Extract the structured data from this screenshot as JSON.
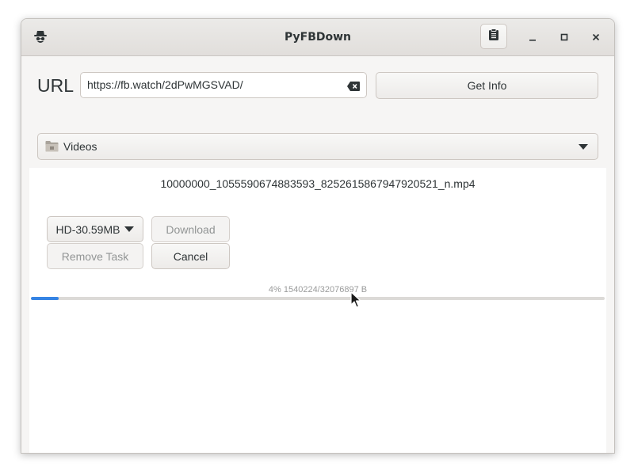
{
  "window": {
    "title": "PyFBDown"
  },
  "icons": {
    "app": "spy-hat-icon",
    "clipboard": "clipboard-icon",
    "minimize": "minimize-icon",
    "maximize": "maximize-icon",
    "close": "close-icon",
    "clear": "backspace-clear-icon",
    "folder": "folder-icon"
  },
  "url_row": {
    "label": "URL",
    "value": "https://fb.watch/2dPwMGSVAD/",
    "get_info_label": "Get Info"
  },
  "folder_select": {
    "selected": "Videos"
  },
  "task": {
    "filename": "10000000_1055590674883593_8252615867947920521_n.mp4",
    "quality_selected": "HD-30.59MB",
    "download_label": "Download",
    "remove_label": "Remove Task",
    "cancel_label": "Cancel",
    "progress_text": "4% 1540224/32076897 B",
    "progress_fraction": 0.048
  },
  "colors": {
    "accent": "#3584e4",
    "window_bg": "#f6f5f4",
    "text": "#2e3436",
    "disabled_text": "#929595"
  }
}
